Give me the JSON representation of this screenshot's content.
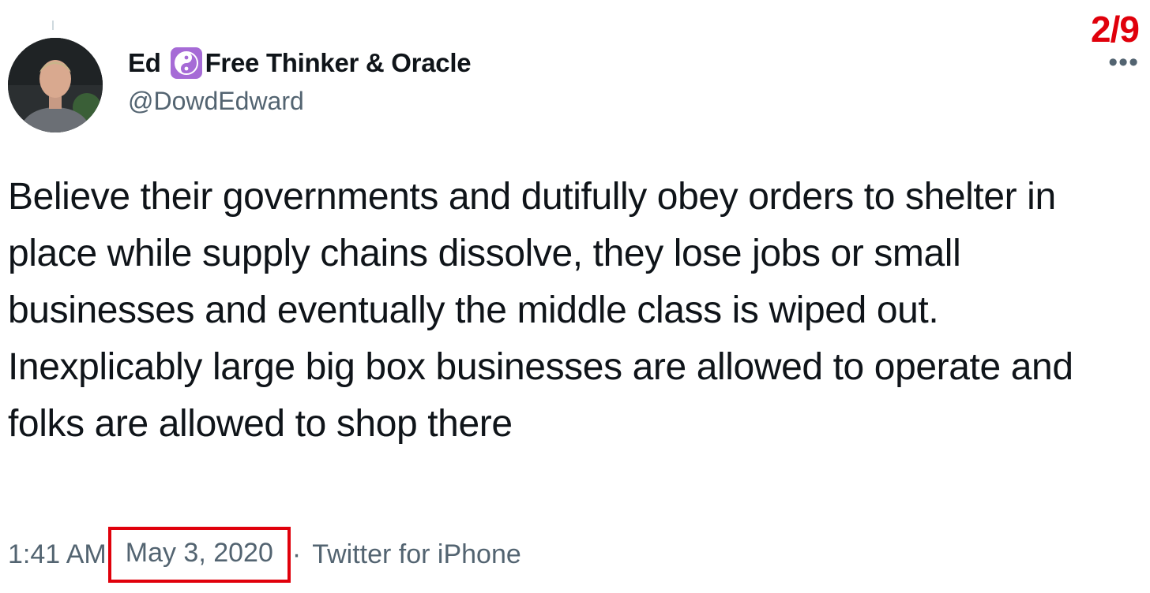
{
  "page": {
    "thread_counter": "2/9",
    "more_icon": "•••"
  },
  "author": {
    "name_prefix": "Ed",
    "badge_icon": "yin-yang-icon",
    "name_suffix": "Free Thinker & Oracle",
    "handle": "@DowdEdward"
  },
  "tweet": {
    "text": "Believe their governments and dutifully obey orders to shelter in place while supply chains dissolve, they lose jobs or small businesses and eventually the middle class is wiped out. Inexplicably large big box businesses are allowed to operate and folks are allowed to shop there",
    "time": "1:41 AM",
    "separator": "·",
    "date": "May 3, 2020",
    "source": "Twitter for iPhone"
  },
  "colors": {
    "highlight": "#e0000b",
    "secondary_text": "#536471",
    "badge": "#a66bd6"
  }
}
